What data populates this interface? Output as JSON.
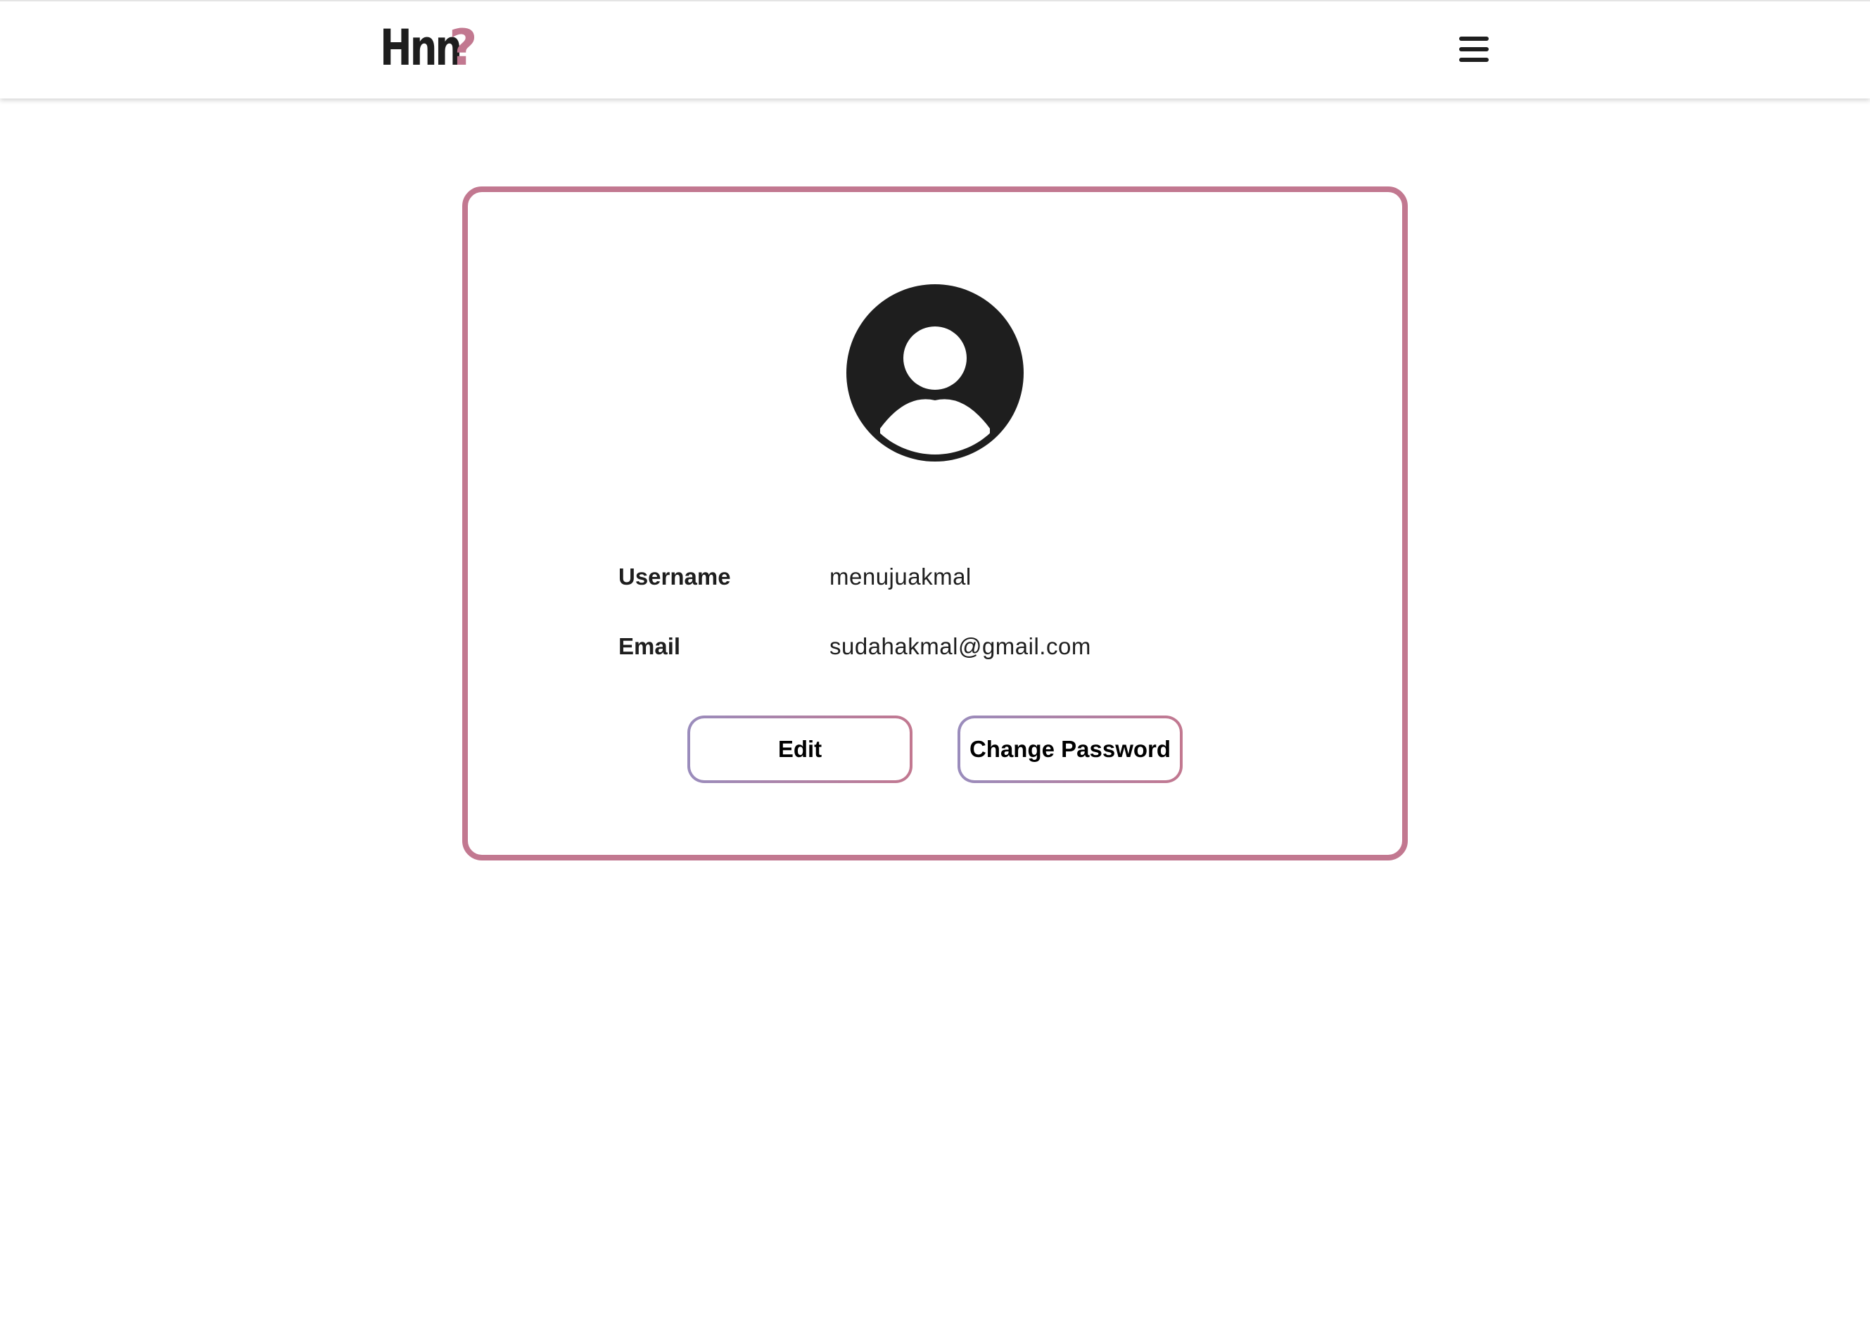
{
  "header": {
    "logo_text": "Hnn",
    "logo_accent": "?",
    "menu_icon": "hamburger-menu-icon"
  },
  "profile": {
    "avatar_icon": "user-avatar-icon",
    "fields": [
      {
        "label": "Username",
        "value": "menujuakmal"
      },
      {
        "label": "Email",
        "value": "sudahakmal@gmail.com"
      }
    ],
    "edit_label": "Edit",
    "change_password_label": "Change Password"
  },
  "colors": {
    "accent": "#c27890",
    "accent_gradient_start": "#9a8cbc",
    "text": "#1e1e1e",
    "background": "#ffffff"
  }
}
